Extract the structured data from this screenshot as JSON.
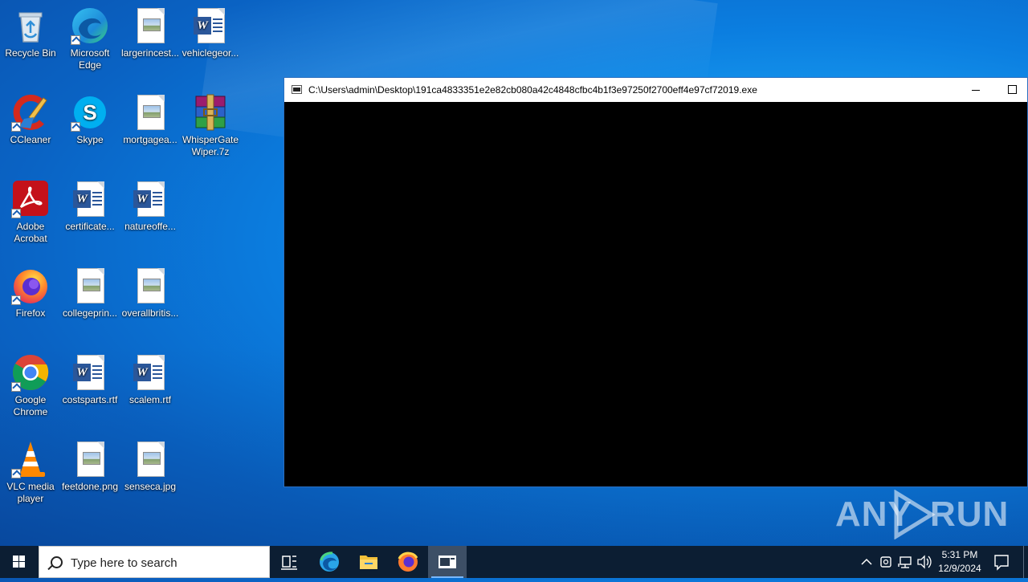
{
  "desktop": {
    "icons": [
      {
        "label": "Recycle Bin"
      },
      {
        "label": "Microsoft Edge"
      },
      {
        "label": "largerincest..."
      },
      {
        "label": "vehiclegeor..."
      },
      {
        "label": "CCleaner"
      },
      {
        "label": "Skype"
      },
      {
        "label": "mortgagea..."
      },
      {
        "label": "WhisperGate Wiper.7z"
      },
      {
        "label": "Adobe Acrobat"
      },
      {
        "label": "certificate..."
      },
      {
        "label": "natureoffe..."
      },
      {
        "label": "Firefox"
      },
      {
        "label": "collegeprin..."
      },
      {
        "label": "overallbritis..."
      },
      {
        "label": "Google Chrome"
      },
      {
        "label": "costsparts.rtf"
      },
      {
        "label": "scalem.rtf"
      },
      {
        "label": "VLC media player"
      },
      {
        "label": "feetdone.png"
      },
      {
        "label": "senseca.jpg"
      }
    ]
  },
  "console_window": {
    "title": "C:\\Users\\admin\\Desktop\\191ca4833351e2e82cb080a42c4848cfbc4b1f3e97250f2700eff4e97cf72019.exe"
  },
  "watermark": {
    "left": "ANY",
    "right": "RUN"
  },
  "taskbar": {
    "search_placeholder": "Type here to search",
    "clock_time": "5:31 PM",
    "clock_date": "12/9/2024"
  }
}
